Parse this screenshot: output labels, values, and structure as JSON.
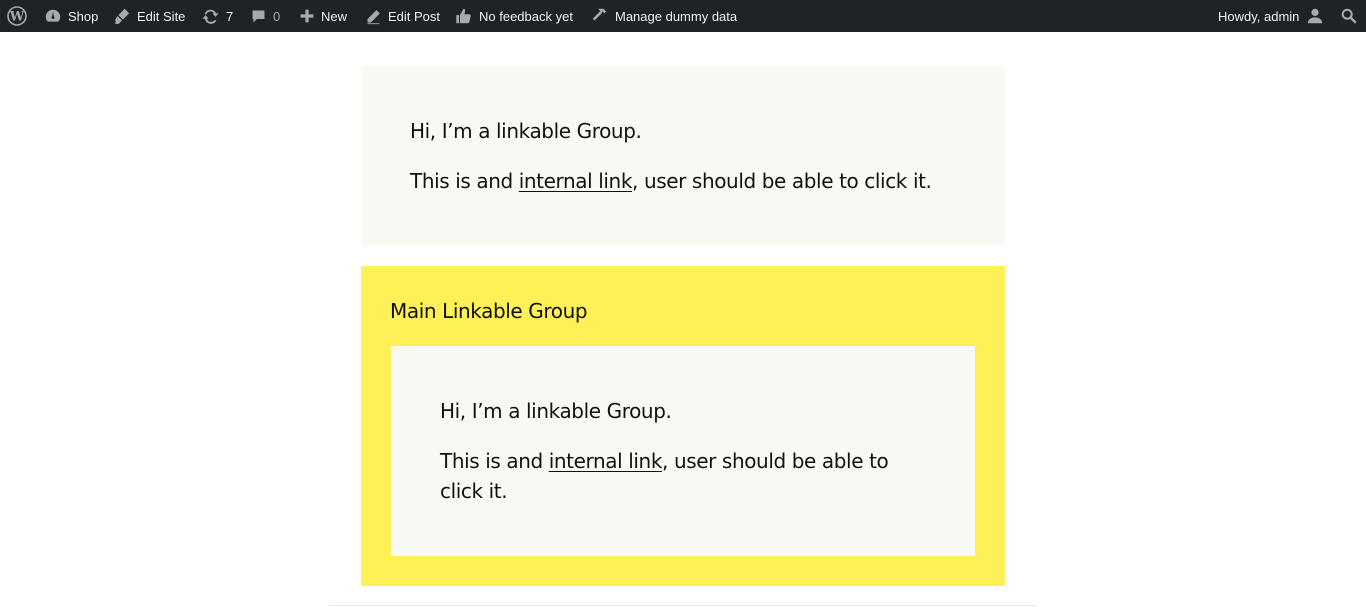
{
  "admin_bar": {
    "items": [
      {
        "icon": "wordpress-logo-icon"
      },
      {
        "icon": "dashboard-icon",
        "label": "Shop"
      },
      {
        "icon": "edit-site-brush-icon",
        "label": "Edit Site"
      },
      {
        "icon": "updates-icon",
        "count": "7"
      },
      {
        "icon": "comments-icon",
        "count": "0"
      },
      {
        "icon": "plus-icon",
        "label": "New"
      },
      {
        "icon": "pencil-icon",
        "label": "Edit Post"
      },
      {
        "icon": "thumbs-up-icon",
        "label": "No feedback yet"
      },
      {
        "icon": "hammer-icon",
        "label": "Manage dummy data"
      }
    ],
    "account": {
      "label": "Howdy, admin",
      "icon": "user-avatar-icon"
    },
    "search": {
      "icon": "search-icon"
    }
  },
  "group1": {
    "line1": "Hi, I’m a linkable Group.",
    "line2_prefix": "This is and ",
    "link": "internal link",
    "line2_suffix": ", user should be able to click it."
  },
  "main_group": {
    "heading": "Main Linkable Group",
    "inner": {
      "line1": "Hi, I’m a linkable Group.",
      "line2_prefix": "This is and ",
      "link": "internal link",
      "line2_suffix": ", user should be able to",
      "line3": "click it."
    }
  },
  "colors": {
    "admin_bar": "#1d2327",
    "group_bg": "#f9f9f4",
    "main_group_bg": "#fff057"
  }
}
